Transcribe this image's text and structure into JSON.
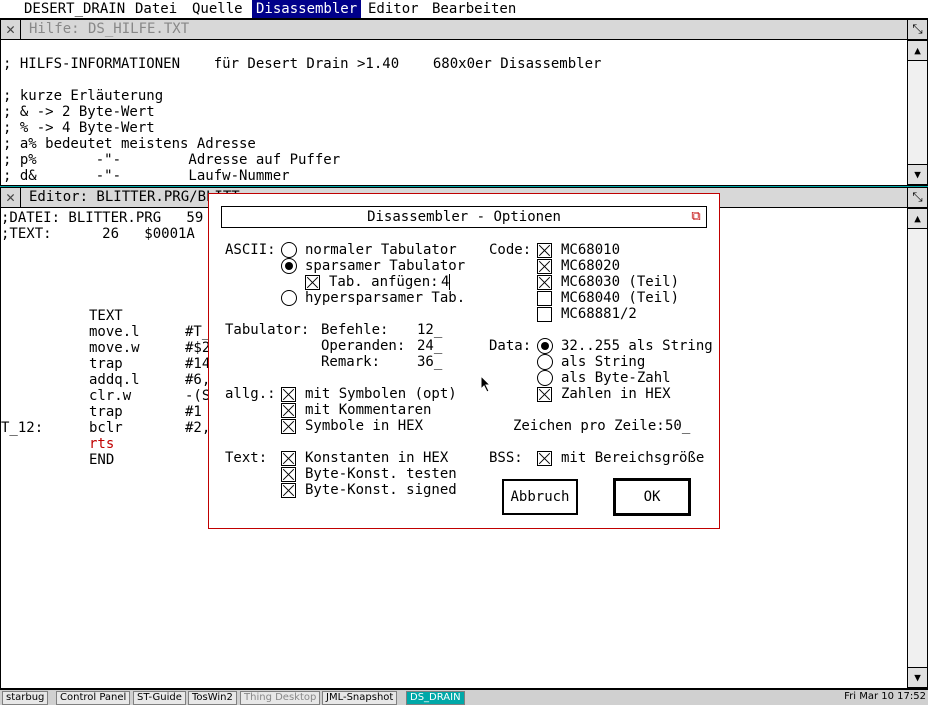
{
  "menubar": {
    "items": [
      "DESERT_DRAIN",
      "Datei",
      "Quelle",
      "Disassembler",
      "Editor",
      "Bearbeiten"
    ],
    "active": "Disassembler"
  },
  "help_window": {
    "title": "Hilfe: DS_HILFE.TXT",
    "lines": [
      "; HILFS-INFORMATIONEN    für Desert Drain >1.40    680x0er Disassembler",
      "",
      "; kurze Erläuterung",
      "; & -> 2 Byte-Wert",
      "; % -> 4 Byte-Wert",
      "; a% bedeutet meistens Adresse",
      "; p%       -\"-        Adresse auf Puffer",
      "; d&       -\"-        Laufw-Nummer"
    ]
  },
  "editor_window": {
    "title": "Editor: BLITTER.PRG/BLITT",
    "header_lines": [
      ";DATEI: BLITTER.PRG   59 B",
      ";TEXT:      26   $0001A"
    ],
    "code": [
      {
        "label": "",
        "op": "TEXT",
        "arg": ""
      },
      {
        "label": "",
        "op": "move.l",
        "arg": "#T_"
      },
      {
        "label": "",
        "op": "move.w",
        "arg": "#$2"
      },
      {
        "label": "",
        "op": "trap",
        "arg": "#14"
      },
      {
        "label": "",
        "op": "addq.l",
        "arg": "#6,"
      },
      {
        "label": "",
        "op": "clr.w",
        "arg": "-(S"
      },
      {
        "label": "",
        "op": "trap",
        "arg": "#1"
      },
      {
        "label": "T_12:",
        "op": "bclr",
        "arg": "#2,"
      },
      {
        "label": "",
        "op": "rts",
        "arg": ""
      },
      {
        "label": "",
        "op": "END",
        "arg": ""
      }
    ]
  },
  "dialog": {
    "title": "Disassembler - Optionen",
    "ascii": {
      "label": "ASCII:",
      "options": [
        {
          "text": "normaler Tabulator",
          "selected": false
        },
        {
          "text": "sparsamer Tabulator",
          "selected": true
        },
        {
          "text": "hypersparsamer Tab.",
          "selected": false
        }
      ],
      "tab_append": {
        "text": "Tab. anfügen:",
        "checked": true,
        "value": "4"
      }
    },
    "tabulator": {
      "label": "Tabulator:",
      "fields": [
        {
          "name": "Befehle:",
          "value": "12_"
        },
        {
          "name": "Operanden:",
          "value": "24_"
        },
        {
          "name": "Remark:",
          "value": "36_"
        }
      ]
    },
    "allg": {
      "label": "allg.:",
      "options": [
        {
          "text": "mit Symbolen (opt)",
          "checked": true
        },
        {
          "text": "mit Kommentaren",
          "checked": true
        },
        {
          "text": "Symbole in HEX",
          "checked": true
        }
      ]
    },
    "text": {
      "label": "Text:",
      "options": [
        {
          "text": "Konstanten in HEX",
          "checked": true
        },
        {
          "text": "Byte-Konst. testen",
          "checked": true
        },
        {
          "text": "Byte-Konst. signed",
          "checked": true
        }
      ]
    },
    "code": {
      "label": "Code:",
      "options": [
        {
          "text": "MC68010",
          "checked": true
        },
        {
          "text": "MC68020",
          "checked": true
        },
        {
          "text": "MC68030 (Teil)",
          "checked": true
        },
        {
          "text": "MC68040 (Teil)",
          "checked": false
        },
        {
          "text": "MC68881/2",
          "checked": false
        }
      ]
    },
    "data": {
      "label": "Data:",
      "options": [
        {
          "text": "32..255 als String",
          "selected": true
        },
        {
          "text": "als String",
          "selected": false
        },
        {
          "text": "als Byte-Zahl",
          "selected": false
        }
      ],
      "hex": {
        "text": "Zahlen in HEX",
        "checked": true
      }
    },
    "chars_per_line": {
      "label": "Zeichen pro Zeile:",
      "value": "50_"
    },
    "bss": {
      "label": "BSS:",
      "text": "mit Bereichsgröße",
      "checked": true
    },
    "buttons": {
      "cancel": "Abbruch",
      "ok": "OK"
    }
  },
  "taskbar": {
    "items": [
      {
        "text": "starbug",
        "state": "normal"
      },
      {
        "text": "Control Panel",
        "state": "normal"
      },
      {
        "text": "ST-Guide",
        "state": "normal"
      },
      {
        "text": "TosWin2",
        "state": "normal"
      },
      {
        "text": "Thing Desktop",
        "state": "dim"
      },
      {
        "text": "JML-Snapshot",
        "state": "normal"
      },
      {
        "text": "DS_DRAIN",
        "state": "active"
      }
    ],
    "clock": "Fri Mar 10 17:52"
  },
  "colors": {
    "desktop": "#00a8a8",
    "menu_active": "#00008a",
    "dialog_border": "#c00000",
    "rts": "#c00000"
  }
}
